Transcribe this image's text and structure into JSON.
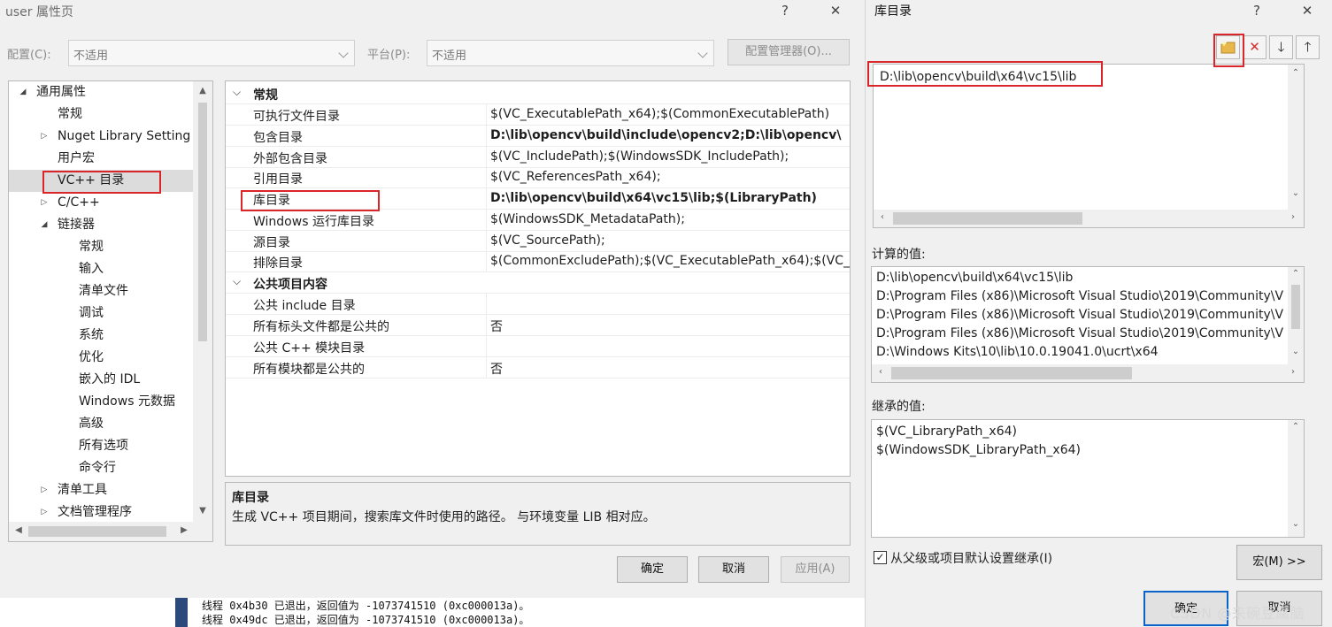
{
  "left_dialog": {
    "title": "user 属性页",
    "help_glyph": "?",
    "close_glyph": "✕",
    "config_label": "配置(C):",
    "config_value": "不适用",
    "platform_label": "平台(P):",
    "platform_value": "不适用",
    "config_manager_button": "配置管理器(O)...",
    "tree": [
      {
        "label": "通用属性",
        "expander": "◢",
        "indent": 0
      },
      {
        "label": "常规",
        "expander": "",
        "indent": 1
      },
      {
        "label": "Nuget Library Setting",
        "expander": "▷",
        "indent": 1
      },
      {
        "label": "用户宏",
        "expander": "",
        "indent": 1
      },
      {
        "label": "VC++ 目录",
        "expander": "",
        "indent": 1
      },
      {
        "label": "C/C++",
        "expander": "▷",
        "indent": 1
      },
      {
        "label": "链接器",
        "expander": "◢",
        "indent": 1
      },
      {
        "label": "常规",
        "expander": "",
        "indent": 2
      },
      {
        "label": "输入",
        "expander": "",
        "indent": 2
      },
      {
        "label": "清单文件",
        "expander": "",
        "indent": 2
      },
      {
        "label": "调试",
        "expander": "",
        "indent": 2
      },
      {
        "label": "系统",
        "expander": "",
        "indent": 2
      },
      {
        "label": "优化",
        "expander": "",
        "indent": 2
      },
      {
        "label": "嵌入的 IDL",
        "expander": "",
        "indent": 2
      },
      {
        "label": "Windows 元数据",
        "expander": "",
        "indent": 2
      },
      {
        "label": "高级",
        "expander": "",
        "indent": 2
      },
      {
        "label": "所有选项",
        "expander": "",
        "indent": 2
      },
      {
        "label": "命令行",
        "expander": "",
        "indent": 2
      },
      {
        "label": "清单工具",
        "expander": "▷",
        "indent": 1
      },
      {
        "label": "文档管理程序",
        "expander": "▷",
        "indent": 1
      }
    ],
    "grid": {
      "cat_general": "常规",
      "cat_public": "公共项目内容",
      "rows": [
        {
          "name": "可执行文件目录",
          "value": "$(VC_ExecutablePath_x64);$(CommonExecutablePath)",
          "bold": false
        },
        {
          "name": "包含目录",
          "value": "D:\\lib\\opencv\\build\\include\\opencv2;D:\\lib\\opencv\\",
          "bold": true
        },
        {
          "name": "外部包含目录",
          "value": "$(VC_IncludePath);$(WindowsSDK_IncludePath);",
          "bold": false
        },
        {
          "name": "引用目录",
          "value": "$(VC_ReferencesPath_x64);",
          "bold": false
        },
        {
          "name": "库目录",
          "value": "D:\\lib\\opencv\\build\\x64\\vc15\\lib;$(LibraryPath)",
          "bold": true
        },
        {
          "name": "Windows 运行库目录",
          "value": "$(WindowsSDK_MetadataPath);",
          "bold": false
        },
        {
          "name": "源目录",
          "value": "$(VC_SourcePath);",
          "bold": false
        },
        {
          "name": "排除目录",
          "value": "$(CommonExcludePath);$(VC_ExecutablePath_x64);$(VC_L",
          "bold": false
        }
      ],
      "public_rows": [
        {
          "name": "公共 include 目录",
          "value": ""
        },
        {
          "name": "所有标头文件都是公共的",
          "value": "否"
        },
        {
          "name": "公共 C++ 模块目录",
          "value": ""
        },
        {
          "name": "所有模块都是公共的",
          "value": "否"
        }
      ]
    },
    "description_title": "库目录",
    "description_text": "生成 VC++ 项目期间，搜索库文件时使用的路径。 与环境变量 LIB 相对应。",
    "ok_button": "确定",
    "cancel_button": "取消",
    "apply_button": "应用(A)"
  },
  "output": {
    "lines": [
      "线程 0x4b30 已退出，返回值为 -1073741510 (0xc000013a)。",
      "线程 0x49dc 已退出，返回值为 -1073741510 (0xc000013a)。"
    ]
  },
  "right_dialog": {
    "title": "库目录",
    "help_glyph": "?",
    "close_glyph": "✕",
    "entries": [
      "D:\\lib\\opencv\\build\\x64\\vc15\\lib"
    ],
    "computed_label": "计算的值:",
    "computed_values": [
      "D:\\lib\\opencv\\build\\x64\\vc15\\lib",
      "D:\\Program Files (x86)\\Microsoft Visual Studio\\2019\\Community\\V",
      "D:\\Program Files (x86)\\Microsoft Visual Studio\\2019\\Community\\V",
      "D:\\Program Files (x86)\\Microsoft Visual Studio\\2019\\Community\\V",
      "D:\\Windows Kits\\10\\lib\\10.0.19041.0\\ucrt\\x64"
    ],
    "inherited_label": "继承的值:",
    "inherited_values": [
      "$(VC_LibraryPath_x64)",
      "$(WindowsSDK_LibraryPath_x64)"
    ],
    "inherit_checkbox_label": "从父级或项目默认设置继承(I)",
    "inherit_checked": "✓",
    "macros_button": "宏(M) >>",
    "ok_button": "确定",
    "cancel_button": "取消",
    "watermark": "CSDN @来碗豆腐脑"
  },
  "icons": {
    "new_line": "new-folder-icon",
    "delete": "delete-x-icon",
    "move_down": "arrow-down-icon",
    "move_up": "arrow-up-icon"
  },
  "colors": {
    "highlight_red": "#d9262b",
    "delete_red": "#d32f2f",
    "folder_yellow": "#e8b84a",
    "output_gutter": "#2b4a7b"
  }
}
